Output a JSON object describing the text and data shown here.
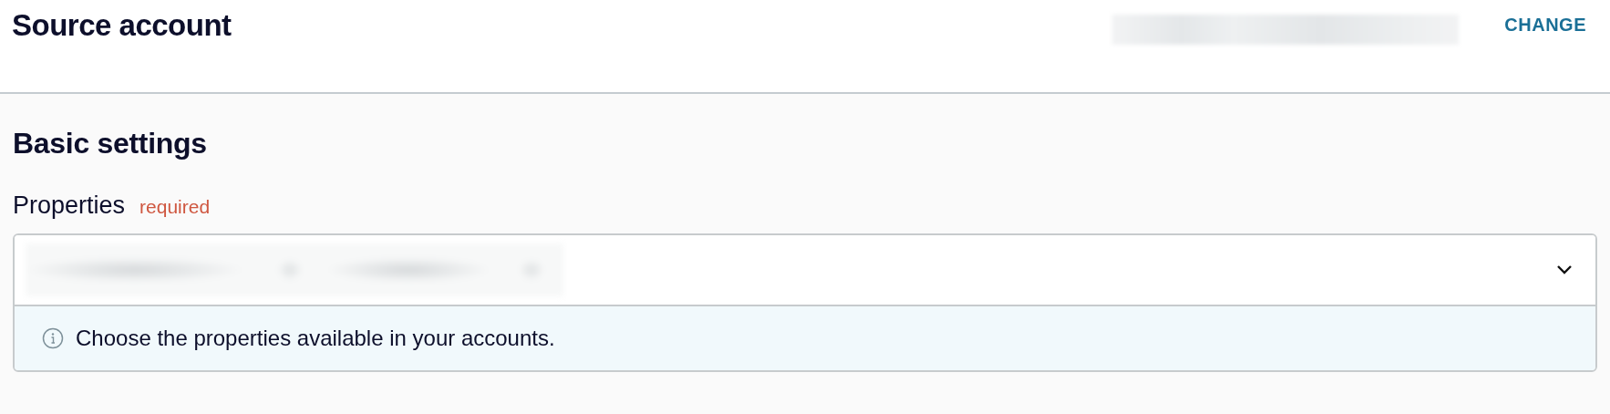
{
  "header": {
    "title": "Source account",
    "action": "CHANGE"
  },
  "section": {
    "title": "Basic settings"
  },
  "properties": {
    "label": "Properties",
    "required": "required",
    "hint": "Choose the properties available in your accounts.",
    "expanded": false
  }
}
